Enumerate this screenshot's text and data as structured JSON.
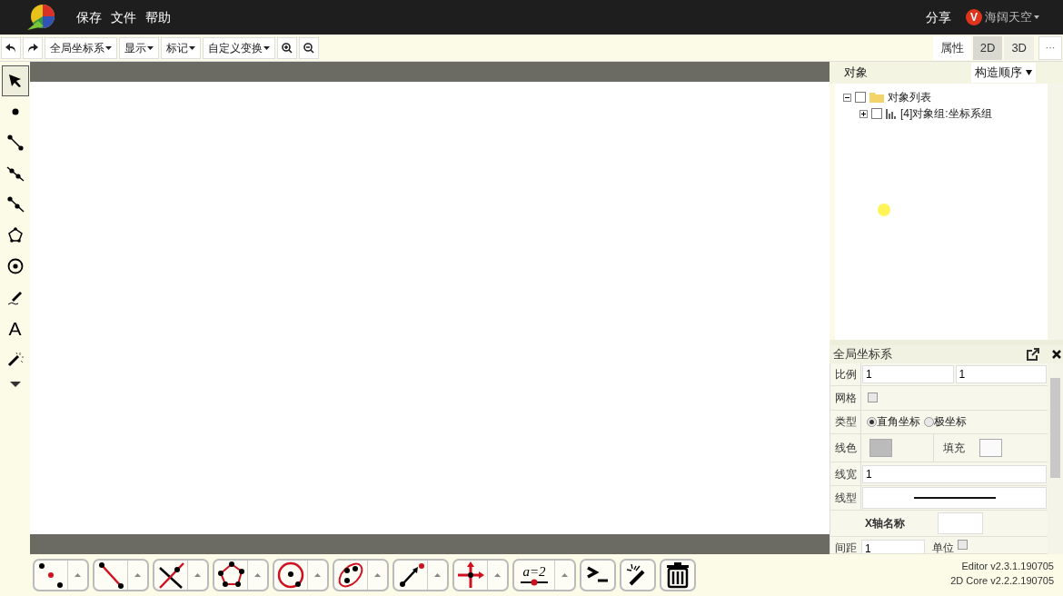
{
  "menu": [
    "保存",
    "文件",
    "帮助"
  ],
  "share": "分享",
  "user": {
    "badge": "V",
    "name": "海阔天空"
  },
  "toolbar": {
    "dropdowns": [
      "全局坐标系",
      "显示",
      "标记",
      "自定义变换"
    ]
  },
  "view_tabs": [
    {
      "label": "属性",
      "selected": false
    },
    {
      "label": "2D",
      "selected": true
    },
    {
      "label": "3D",
      "selected": false
    }
  ],
  "more": "···",
  "left_tools": [
    {
      "kind": "pointer",
      "selected": true
    },
    {
      "kind": "point",
      "selected": false
    },
    {
      "kind": "segment",
      "selected": false
    },
    {
      "kind": "line",
      "selected": false
    },
    {
      "kind": "ray",
      "selected": false
    },
    {
      "kind": "polygon",
      "selected": false
    },
    {
      "kind": "circle",
      "selected": false
    },
    {
      "kind": "pen",
      "selected": false
    },
    {
      "kind": "text",
      "label": "A",
      "selected": false
    },
    {
      "kind": "wand",
      "selected": false
    },
    {
      "kind": "more",
      "selected": false
    }
  ],
  "object_panel": {
    "title": "对象",
    "sort": "构造顺序",
    "tree": [
      {
        "label": "对象列表",
        "kind": "folder",
        "expanded": true,
        "checked": false,
        "children": [
          {
            "label": "[4]对象组:坐标系组",
            "kind": "group",
            "expanded": false,
            "checked": false
          }
        ]
      }
    ]
  },
  "properties": {
    "title": "全局坐标系",
    "rows": [
      {
        "kind": "pair",
        "label": "比例",
        "values": [
          "1",
          "1"
        ]
      },
      {
        "kind": "checkbox",
        "label": "网格",
        "checked": false
      },
      {
        "kind": "radio",
        "label": "类型",
        "options": [
          {
            "label": "直角坐标",
            "selected": true
          },
          {
            "label": "极坐标",
            "selected": false
          }
        ]
      },
      {
        "kind": "colors",
        "label": "线色",
        "second_label": "填充"
      },
      {
        "kind": "text",
        "label": "线宽",
        "value": "1"
      },
      {
        "kind": "linestyle",
        "label": "线型"
      },
      {
        "kind": "name",
        "label": "X轴名称"
      },
      {
        "kind": "spacing",
        "label": "间距",
        "value": "1",
        "unit_label": "单位",
        "checked": false
      }
    ]
  },
  "bottom_tools": [
    {
      "kind": "points",
      "has_menu": true
    },
    {
      "kind": "segment",
      "has_menu": true
    },
    {
      "kind": "intersect",
      "has_menu": true
    },
    {
      "kind": "polygon",
      "has_menu": true
    },
    {
      "kind": "circle",
      "has_menu": true
    },
    {
      "kind": "conic",
      "has_menu": true
    },
    {
      "kind": "vector",
      "has_menu": true
    },
    {
      "kind": "axes",
      "has_menu": true
    },
    {
      "kind": "slider",
      "label": "a=2",
      "has_menu": true
    },
    {
      "kind": "console",
      "has_menu": false
    },
    {
      "kind": "wand",
      "has_menu": false
    },
    {
      "kind": "trash",
      "has_menu": false
    }
  ],
  "version": [
    "Editor v2.3.1.190705",
    "2D Core v2.2.2.190705"
  ]
}
